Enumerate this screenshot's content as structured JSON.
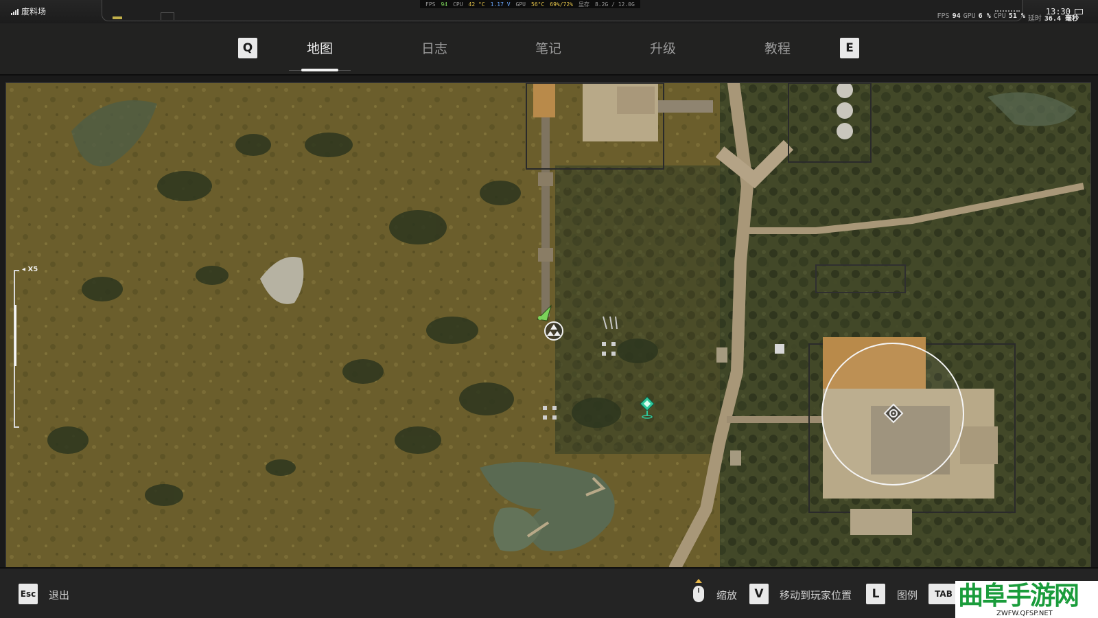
{
  "status_bar": {
    "zone": "废料场",
    "perf": {
      "fps_label": "FPS",
      "fps": "94",
      "cpu_label": "CPU",
      "cpu_temp": "42 °C",
      "cpu_volt": "1.17 V",
      "gpu_label": "GPU",
      "gpu_temp": "56°C",
      "gpu_usage": "69%/72%",
      "vram_label": "显存",
      "vram": "8.2G / 12.0G"
    },
    "hud": {
      "fps_label": "FPS",
      "fps": "94",
      "gpu_label": "GPU",
      "gpu": "6 %",
      "cpu_label": "CPU",
      "cpu": "51 %",
      "latency_label": "延时",
      "latency": "36.4 毫秒"
    },
    "time": "13:30"
  },
  "tabs": {
    "prev_key": "Q",
    "next_key": "E",
    "items": [
      {
        "label": "地图"
      },
      {
        "label": "日志"
      },
      {
        "label": "笔记"
      },
      {
        "label": "升级"
      },
      {
        "label": "教程"
      }
    ]
  },
  "map": {
    "zoom_label": "X5",
    "zoom_fraction": 0.7,
    "markers": [
      {
        "name": "player-marker",
        "icon": "green-arrow"
      },
      {
        "name": "anomaly-marker",
        "icon": "triangle-circle"
      },
      {
        "name": "quest-marker",
        "icon": "green-pin"
      },
      {
        "name": "target-marker",
        "icon": "diamond-circle"
      }
    ],
    "colors": {
      "grass": "#6b5e2c",
      "trees": "#2f3820",
      "road": "#a89778",
      "water": "#5a6a52",
      "player": "#7bd35a",
      "quest": "#2fc79b"
    }
  },
  "bottom": {
    "esc_key": "Esc",
    "exit_label": "退出",
    "zoom_label": "缩放",
    "v_key": "V",
    "move_label": "移动到玩家位置",
    "l_key": "L",
    "legend_label": "图例",
    "tab_key": "TAB"
  },
  "watermark": {
    "title": "曲阜手游网",
    "url": "ZWFW.QFSP.NET"
  }
}
